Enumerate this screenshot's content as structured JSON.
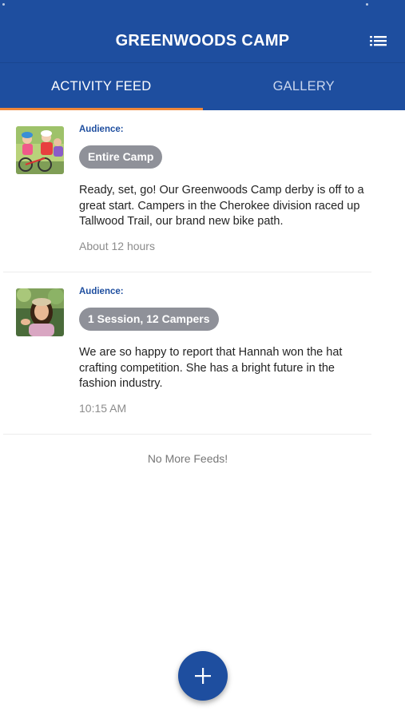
{
  "app": {
    "title": "GREENWOODS CAMP",
    "brand_color": "#1e4e9f",
    "accent_color": "#f0883a",
    "menu_icon": "list-icon"
  },
  "tabs": [
    {
      "label": "ACTIVITY FEED",
      "active": true
    },
    {
      "label": "GALLERY",
      "active": false
    }
  ],
  "feed": {
    "posts": [
      {
        "avatar": "bike-riders-photo",
        "audience_label": "Audience:",
        "audience": "Entire Camp",
        "text": "Ready, set, go! Our Greenwoods Camp derby is off to a great start. Campers in the Cherokee division raced up Tallwood Trail, our brand new bike path.",
        "time": "About 12 hours"
      },
      {
        "avatar": "girl-portrait-photo",
        "audience_label": "Audience:",
        "audience": "1 Session, 12 Campers",
        "text": "We are so happy to report that Hannah won the hat crafting competition. She has a bright future in the fashion industry.",
        "time": "10:15 AM"
      }
    ],
    "end_message": "No More Feeds!"
  },
  "fab": {
    "icon": "plus-icon"
  }
}
